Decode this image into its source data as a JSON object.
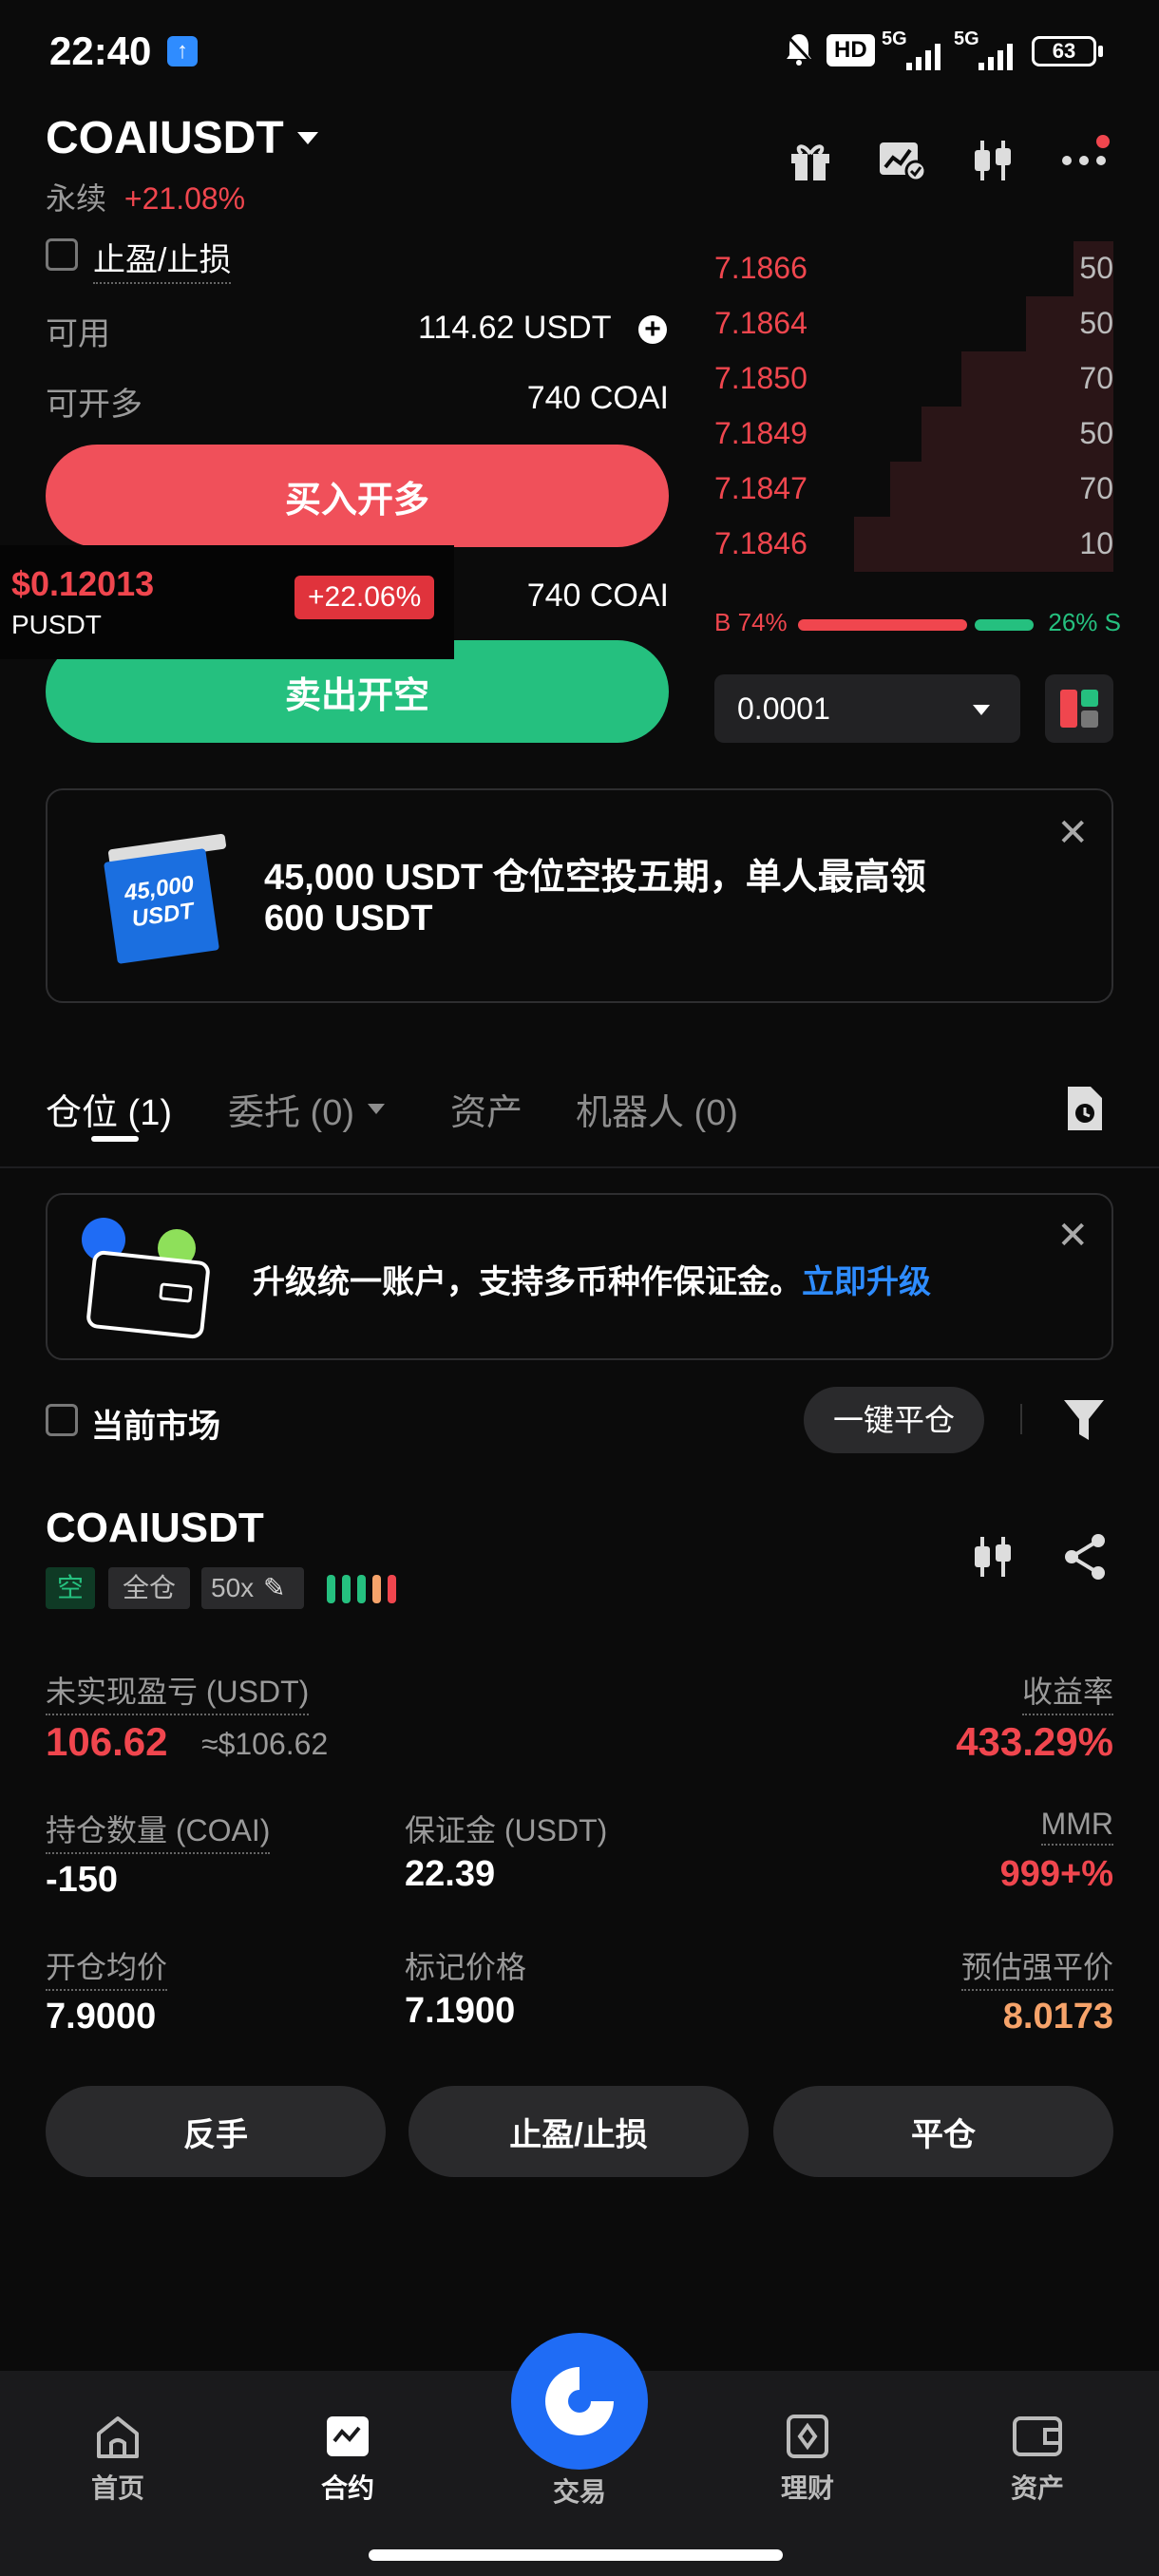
{
  "status_bar": {
    "time": "22:40",
    "hd": "HD",
    "net1": "5G",
    "net2": "5G",
    "battery": "63"
  },
  "header": {
    "symbol": "COAIUSDT",
    "type": "永续",
    "change": "+21.08%"
  },
  "tpsl_checkbox": {
    "label": "止盈/止损"
  },
  "balance": {
    "available_label": "可用",
    "available_value": "114.62 USDT",
    "long_label": "可开多",
    "long_value": "740 COAI",
    "short_value": "740 COAI"
  },
  "buttons": {
    "buy": "买入开多",
    "sell": "卖出开空"
  },
  "floating_ticker": {
    "price": "$0.12013",
    "symbol": "PUSDT",
    "change": "+22.06%"
  },
  "orderbook": {
    "asks": [
      {
        "price": "7.1866",
        "qty": "50",
        "depth": 0.1
      },
      {
        "price": "7.1864",
        "qty": "50",
        "depth": 0.22
      },
      {
        "price": "7.1850",
        "qty": "70",
        "depth": 0.38
      },
      {
        "price": "7.1849",
        "qty": "50",
        "depth": 0.48
      },
      {
        "price": "7.1847",
        "qty": "70",
        "depth": 0.56
      },
      {
        "price": "7.1846",
        "qty": "10",
        "depth": 0.65
      }
    ],
    "ratio_buy": "B 74%",
    "ratio_sell": "26% S",
    "buy_share": 0.74,
    "precision": "0.0001"
  },
  "promo": {
    "text_line1": "45,000 USDT 仓位空投五期，单人最高领",
    "text_line2": "600 USDT",
    "badge_line1": "45,000",
    "badge_line2": "USDT"
  },
  "tabs": [
    {
      "label": "仓位 (1)"
    },
    {
      "label": "委托 (0)"
    },
    {
      "label": "资产"
    },
    {
      "label": "机器人 (0)"
    }
  ],
  "upgrade": {
    "text": "升级统一账户，支持多币种作保证金。",
    "link": "立即升级"
  },
  "filter": {
    "current_market": "当前市场",
    "close_all": "一键平仓"
  },
  "position": {
    "symbol": "COAIUSDT",
    "side": "空",
    "mode": "全仓",
    "leverage": "50x",
    "upnl_label": "未实现盈亏 (USDT)",
    "upnl_value": "106.62",
    "upnl_usd": "≈$106.62",
    "roe_label": "收益率",
    "roe_value": "433.29%",
    "qty_label": "持仓数量 (COAI)",
    "qty_value": "-150",
    "margin_label": "保证金 (USDT)",
    "margin_value": "22.39",
    "mmr_label": "MMR",
    "mmr_value": "999+%",
    "entry_label": "开仓均价",
    "entry_value": "7.9000",
    "mark_label": "标记价格",
    "mark_value": "7.1900",
    "liq_label": "预估强平价",
    "liq_value": "8.0173",
    "btn_reverse": "反手",
    "btn_tpsl": "止盈/止损",
    "btn_close": "平仓"
  },
  "nav": [
    {
      "label": "首页"
    },
    {
      "label": "合约"
    },
    {
      "label": "交易"
    },
    {
      "label": "理财"
    },
    {
      "label": "资产"
    }
  ],
  "colors": {
    "red": "#f0464e",
    "green": "#25c07f",
    "orange": "#f6a36a",
    "blue": "#1f6cf5"
  }
}
